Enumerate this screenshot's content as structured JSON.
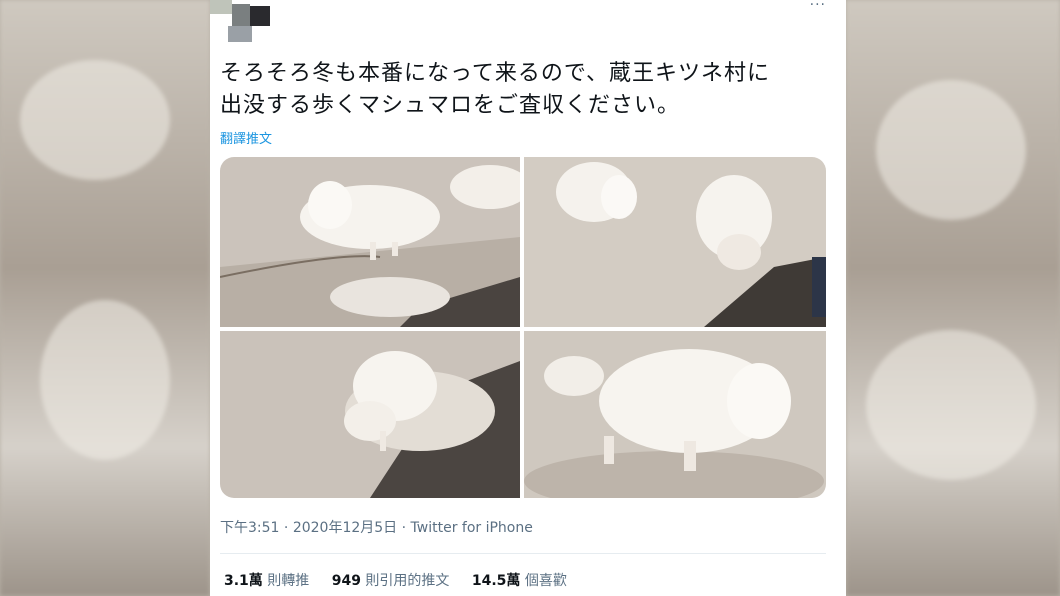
{
  "tweet": {
    "text_line1": "そろそろ冬も本番になって来るので、蔵王キツネ村に",
    "text_line2": "出没する歩くマシュマロをご査収ください。",
    "translate_label": "翻譯推文",
    "more_label": "···"
  },
  "photos": [
    {
      "name": "photo-1"
    },
    {
      "name": "photo-2"
    },
    {
      "name": "photo-3"
    },
    {
      "name": "photo-4"
    }
  ],
  "meta": {
    "time": "下午3:51",
    "date": "2020年12月5日",
    "source": "Twitter for iPhone",
    "sep": "·"
  },
  "stats": {
    "retweets_num": "3.1萬",
    "retweets_label": "則轉推",
    "quotes_num": "949",
    "quotes_label": "則引用的推文",
    "likes_num": "14.5萬",
    "likes_label": "個喜歡"
  },
  "colors": {
    "text": "#0f1419",
    "secondary": "#5b7083",
    "link": "#1b95e0"
  }
}
